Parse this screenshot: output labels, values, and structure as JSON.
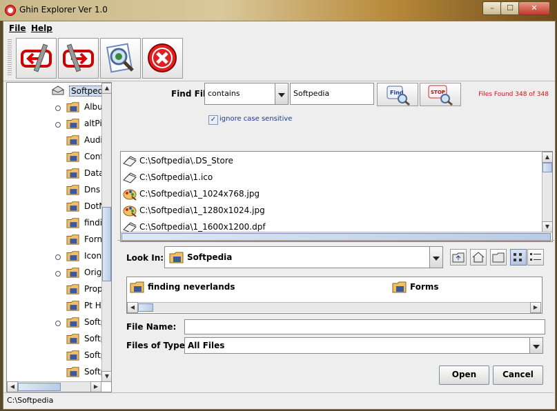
{
  "window": {
    "title": "Ghin Explorer Ver 1.0",
    "min_label": "–",
    "max_label": "☐",
    "close_label": "✕"
  },
  "menu": {
    "file": "File",
    "help": "Help"
  },
  "toolbar": {
    "back": "back-icon",
    "forward": "forward-icon",
    "preview": "preview-icon",
    "exit": "exit-icon"
  },
  "tree": {
    "root": "Softpedia",
    "items": [
      "Albu",
      "altPi",
      "Audi",
      "Conf",
      "Data",
      "Dns",
      "DotN",
      "findi",
      "Forn",
      "Icon",
      "Origi",
      "Prop",
      "Pt H",
      "Softp",
      "Softp",
      "Softp",
      "Softp"
    ]
  },
  "find": {
    "label": "Find File",
    "mode": "contains",
    "query": "Softpedia",
    "find_btn": "Find",
    "stop_btn": "STOP",
    "count": "Files Found 348 of 348",
    "ignore_case": "ignore case sensitive"
  },
  "results": [
    {
      "path": "C:\\Softpedia\\.DS_Store",
      "icon": "file-icon"
    },
    {
      "path": "C:\\Softpedia\\1.ico",
      "icon": "file-icon"
    },
    {
      "path": "C:\\Softpedia\\1_1024x768.jpg",
      "icon": "image-icon"
    },
    {
      "path": "C:\\Softpedia\\1_1280x1024.jpg",
      "icon": "image-icon"
    },
    {
      "path": "C:\\Softpedia\\1_1600x1200.dpf",
      "icon": "file-icon"
    }
  ],
  "chooser": {
    "look_in_label": "Look In:",
    "look_in_value": "Softpedia",
    "dirs": [
      "finding neverlands",
      "Forms"
    ],
    "file_name_label": "File Name:",
    "file_name_value": "",
    "type_label": "Files of Type:",
    "type_value": "All Files",
    "open": "Open",
    "cancel": "Cancel"
  },
  "status": {
    "path": "C:\\Softpedia"
  },
  "colors": {
    "count": "#d01010",
    "accent": "#1a3a8a"
  }
}
